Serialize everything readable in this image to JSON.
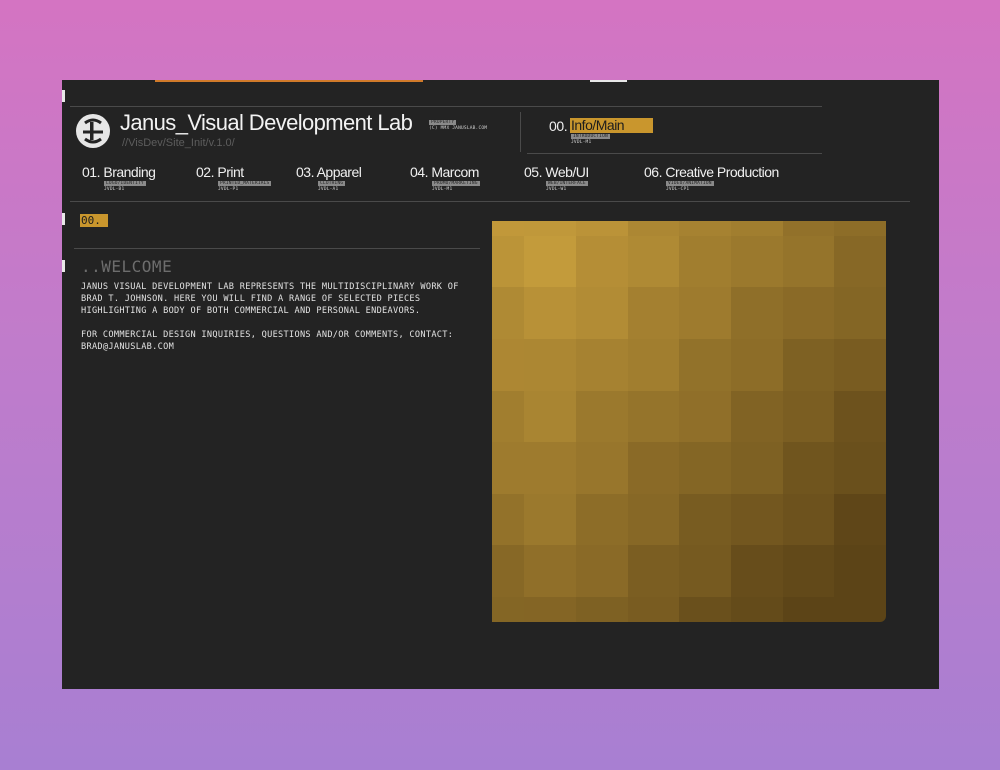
{
  "header": {
    "site_title": "Janus_Visual Development Lab",
    "site_subtitle": "//VisDev/Site_Init/v.1.0/",
    "tiny_tag": "PROPERTY",
    "copyright": "(C) MMX JANUSLAB.COM"
  },
  "info": {
    "number": "00.",
    "label": "Info/Main",
    "tag": "INTRODUCTION",
    "code": "JVDL-M1"
  },
  "nav": [
    {
      "number": "01.",
      "label": "Branding",
      "tag": "LOGO/IDENTITY",
      "code": "JVDL-B1"
    },
    {
      "number": "02.",
      "label": "Print",
      "tag": "PRINTED_MATERIALS",
      "code": "JVDL-P1"
    },
    {
      "number": "03.",
      "label": "Apparel",
      "tag": "CLOTHING",
      "code": "JVDL-A1"
    },
    {
      "number": "04.",
      "label": "Marcom",
      "tag": "PROMO/MARKETING",
      "code": "JVDL-M1"
    },
    {
      "number": "05.",
      "label": "Web/UI",
      "tag": "WEB/INTERFACE",
      "code": "JVDL-W1"
    },
    {
      "number": "06.",
      "label": "Creative Production",
      "tag": "VIDEO/ANIMATION",
      "code": "JVDL-CP1"
    }
  ],
  "content": {
    "section_badge": "00.",
    "heading": "..WELCOME",
    "paragraph1": "JANUS VISUAL DEVELOPMENT LAB REPRESENTS THE MULTIDISCIPLINARY WORK OF BRAD T. JOHNSON. HERE YOU WILL FIND A RANGE OF SELECTED PIECES HIGHLIGHTING A BODY OF BOTH COMMERCIAL AND PERSONAL ENDEAVORS.",
    "paragraph2": "FOR COMMERCIAL DESIGN INQUIRIES, QUESTIONS AND/OR COMMENTS, CONTACT: BRAD@JANUSLAB.COM"
  },
  "colors": {
    "accent": "#c9962d",
    "background": "#232323",
    "mosaic_light": "#d1a640",
    "mosaic_dark": "#5c4417"
  }
}
